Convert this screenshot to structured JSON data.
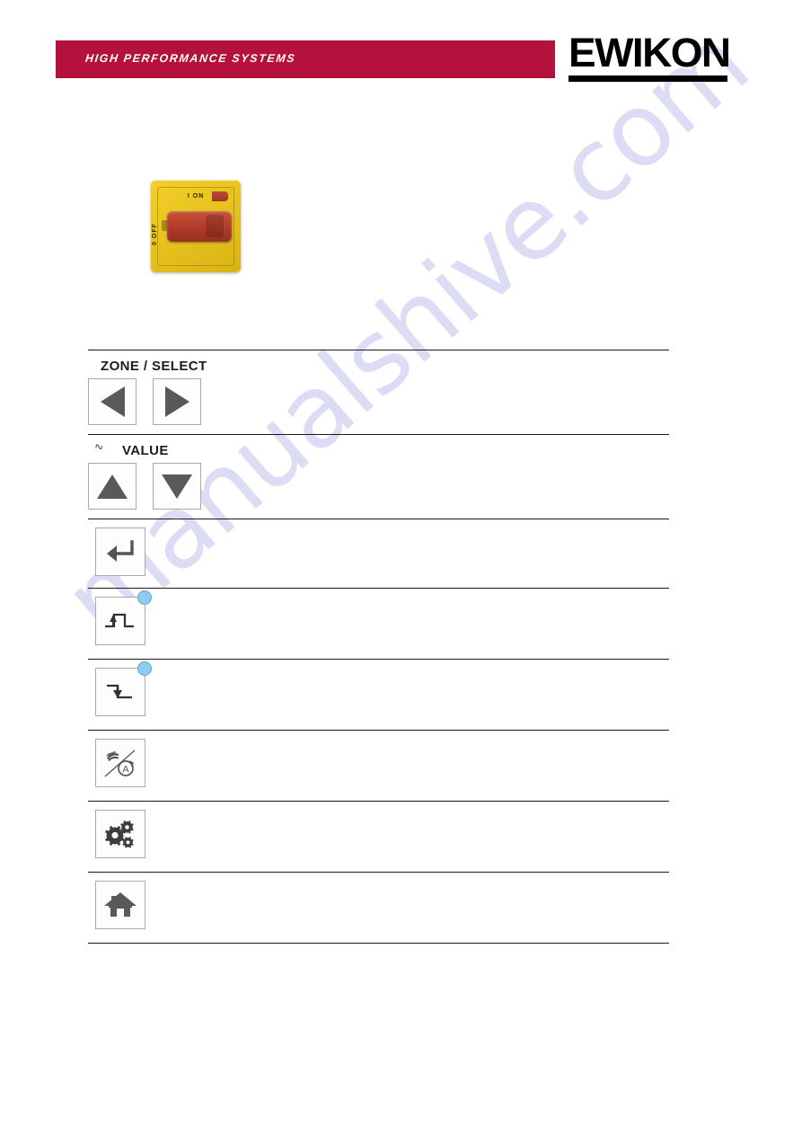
{
  "header": {
    "tagline": "HIGH PERFORMANCE SYSTEMS",
    "logo_text": "EWIKON",
    "bar_color": "#b4123c",
    "logo_color": "#000000"
  },
  "watermark": {
    "text": "manualshive.com",
    "color": "#c9c7ef"
  },
  "figure": {
    "name": "main-switch",
    "plate_color": "#e8c31e",
    "knob_color": "#b8402c",
    "on_label": "I  ON",
    "off_label": "0 OFF"
  },
  "key_table": {
    "rows": [
      {
        "id": "zone-select",
        "group_label": "ZONE / SELECT",
        "icons": [
          "triangle-left-icon",
          "triangle-right-icon"
        ],
        "description": ""
      },
      {
        "id": "value",
        "group_label": "VALUE",
        "marker": "squiggle-mark",
        "icons": [
          "triangle-up-icon",
          "triangle-down-icon"
        ],
        "description": ""
      },
      {
        "id": "enter",
        "group_label": "",
        "icons": [
          "enter-key-icon"
        ],
        "description": ""
      },
      {
        "id": "boost",
        "group_label": "",
        "icons": [
          "boost-step-up-icon"
        ],
        "led": "blue-led-indicator",
        "led_color": "#8ecbec",
        "description": ""
      },
      {
        "id": "standby",
        "group_label": "",
        "icons": [
          "standby-step-down-icon"
        ],
        "led": "blue-led-indicator",
        "led_color": "#8ecbec",
        "description": ""
      },
      {
        "id": "manual-auto",
        "group_label": "",
        "icons": [
          "manual-automatic-icon"
        ],
        "description": ""
      },
      {
        "id": "settings",
        "group_label": "",
        "icons": [
          "gears-settings-icon"
        ],
        "description": ""
      },
      {
        "id": "home",
        "group_label": "",
        "icons": [
          "home-icon"
        ],
        "description": ""
      }
    ]
  }
}
